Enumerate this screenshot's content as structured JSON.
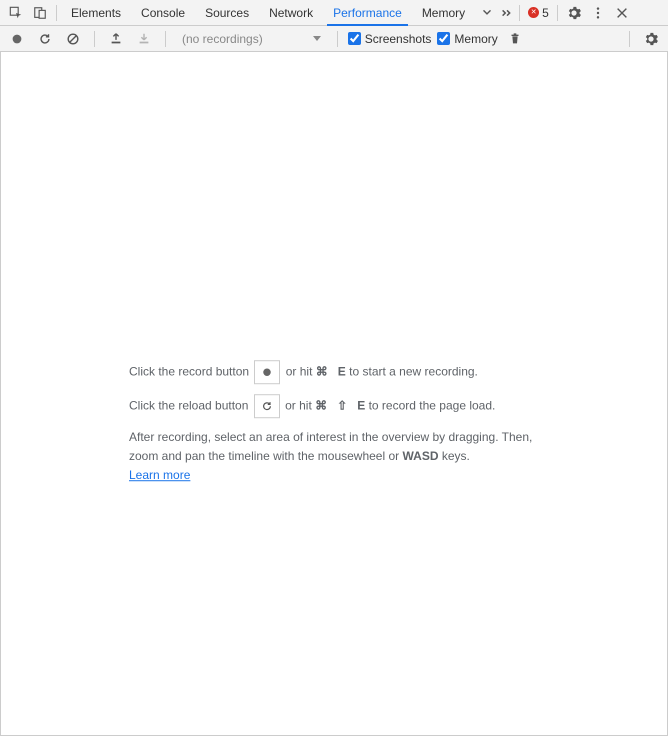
{
  "tabs": {
    "elements": "Elements",
    "console": "Console",
    "sources": "Sources",
    "network": "Network",
    "performance": "Performance",
    "memory": "Memory"
  },
  "error_count": "5",
  "subbar": {
    "no_recordings": "(no recordings)",
    "screenshots_label": "Screenshots",
    "memory_label": "Memory"
  },
  "placeholder": {
    "line1_a": "Click the record button ",
    "line1_b": " or hit ",
    "shortcut1_mod": "⌘",
    "shortcut1_key": "E",
    "line1_c": " to start a new recording.",
    "line2_a": "Click the reload button ",
    "line2_b": " or hit ",
    "shortcut2_mod": "⌘",
    "shortcut2_shift": "⇧",
    "shortcut2_key": "E",
    "line2_c": " to record the page load.",
    "para2_a": "After recording, select an area of interest in the overview by dragging. Then, zoom and pan the timeline with the mousewheel or ",
    "wasd": "WASD",
    "para2_b": " keys.",
    "learn_more": "Learn more"
  }
}
